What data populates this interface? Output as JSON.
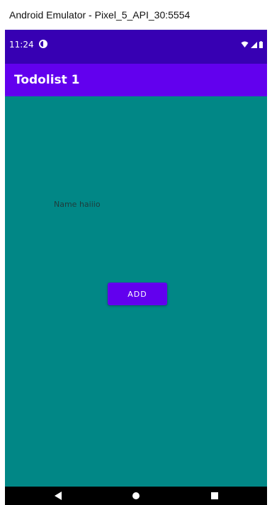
{
  "window": {
    "title": "Android Emulator - Pixel_5_API_30:5554"
  },
  "status_bar": {
    "time": "11:24",
    "left_icon": "data-saver-icon",
    "right_icons": [
      "wifi-icon",
      "signal-icon",
      "battery-icon"
    ]
  },
  "app_bar": {
    "title": "Todolist 1"
  },
  "main": {
    "name_text": "Name haiiio",
    "add_button_label": "ADD"
  },
  "nav_bar": {
    "icons": [
      "back-icon",
      "home-icon",
      "recents-icon"
    ]
  },
  "colors": {
    "status_bar": "#3700B3",
    "app_bar": "#6200EE",
    "background": "#018786",
    "button": "#6200EE",
    "nav_bar": "#000000"
  }
}
